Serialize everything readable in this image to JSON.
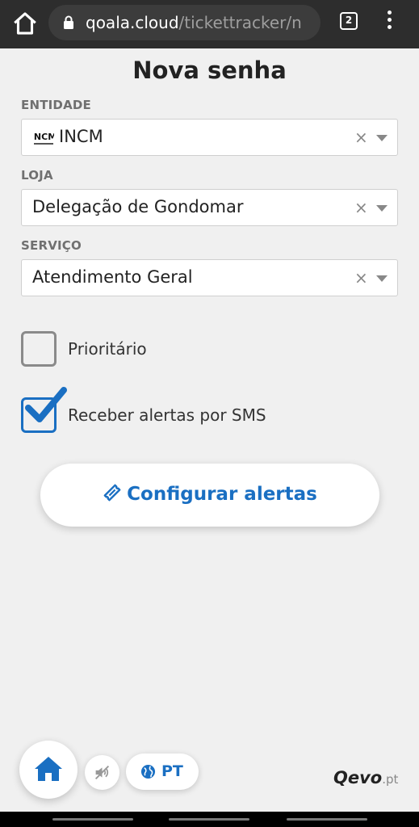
{
  "browser": {
    "url_host": "qoala.cloud",
    "url_path": "/tickettracker/n",
    "tab_count": "2"
  },
  "page": {
    "title": "Nova senha"
  },
  "form": {
    "entidade": {
      "label": "ENTIDADE",
      "value": "INCM",
      "logo_text": "INCM"
    },
    "loja": {
      "label": "LOJA",
      "value": "Delegação de Gondomar"
    },
    "servico": {
      "label": "SERVIÇO",
      "value": "Atendimento Geral"
    },
    "clear_glyph": "×",
    "prioritario": {
      "label": "Prioritário",
      "checked": false
    },
    "sms": {
      "label": "Receber alertas por SMS",
      "checked": true
    }
  },
  "actions": {
    "config_alerts_label": "Configurar alertas"
  },
  "footer": {
    "language": "PT",
    "brand_main": "Qevo",
    "brand_suffix": ".pt"
  },
  "colors": {
    "accent": "#1a6fc2",
    "background": "#f0f0f0",
    "browser_bar": "#2d2d2d"
  },
  "icons": [
    "home-icon",
    "lock-icon",
    "tab-switcher-icon",
    "more-vert-icon",
    "chevron-down-icon",
    "close-icon",
    "check-icon",
    "ticket-icon",
    "volume-off-icon",
    "globe-icon"
  ]
}
